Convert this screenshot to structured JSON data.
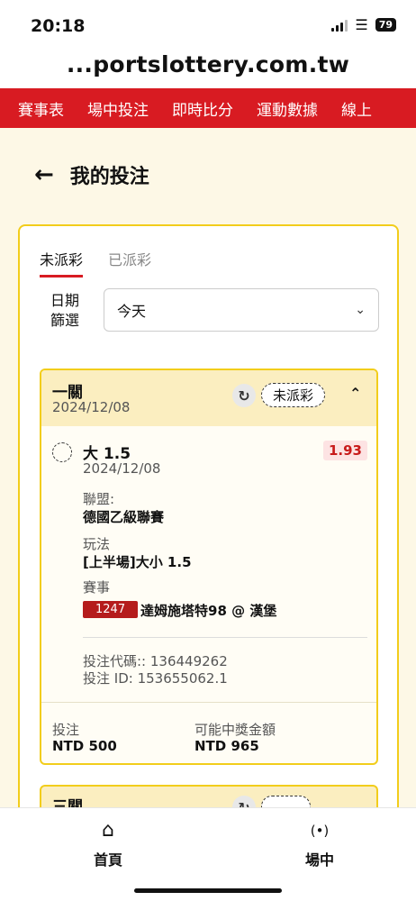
{
  "status_bar": {
    "time": "20:18",
    "battery": "79"
  },
  "browser": {
    "url": "...portslottery.com.tw"
  },
  "nav": {
    "items": [
      "賽事表",
      "場中投注",
      "即時比分",
      "運動數據",
      "線上"
    ]
  },
  "page": {
    "title": "我的投注"
  },
  "tabs": [
    {
      "label": "未派彩"
    },
    {
      "label": "已派彩"
    }
  ],
  "filter": {
    "label": "日期\n篩選",
    "value": "今天"
  },
  "bets": [
    {
      "type": "一關",
      "date": "2024/12/08",
      "status": "未派彩",
      "selection": "大 1.5",
      "odds": "1.93",
      "selection_date": "2024/12/08",
      "league_label": "聯盟:",
      "league": "德國乙級聯賽",
      "market_label": "玩法",
      "market": "[上半場]大小 1.5",
      "event_label": "賽事",
      "event_id": "1247",
      "event": "達姆施塔特98 @ 漢堡",
      "code_line": "投注代碼:: 136449262",
      "id_line": "投注 ID: 153655062.1",
      "stake_label": "投注",
      "stake": "NTD 500",
      "payout_label": "可能中獎金額",
      "payout": "NTD 965"
    },
    {
      "type": "三關"
    }
  ],
  "bottom_nav": {
    "home_label": "首頁",
    "live_label": "場中"
  },
  "colors": {
    "brand_red": "#d81b22",
    "accent_yellow": "#f2cd1b",
    "page_bg": "#fdf8e6"
  }
}
